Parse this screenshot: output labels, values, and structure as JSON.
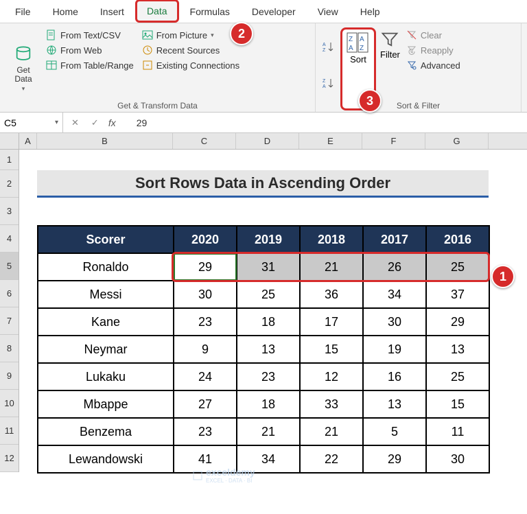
{
  "tabs": [
    "File",
    "Home",
    "Insert",
    "Data",
    "Formulas",
    "Developer",
    "View",
    "Help"
  ],
  "active_tab": "Data",
  "ribbon": {
    "get_data": "Get\nData",
    "from_textcsv": "From Text/CSV",
    "from_web": "From Web",
    "from_table": "From Table/Range",
    "from_picture": "From Picture",
    "recent_sources": "Recent Sources",
    "existing_conn": "Existing Connections",
    "group1_label": "Get & Transform Data",
    "sort_asc": "A→Z",
    "sort_desc": "Z→A",
    "sort": "Sort",
    "filter": "Filter",
    "clear": "Clear",
    "reapply": "Reapply",
    "advanced": "Advanced",
    "group2_label": "Sort & Filter"
  },
  "namebox": "C5",
  "formula_value": "29",
  "columns": [
    "A",
    "B",
    "C",
    "D",
    "E",
    "F",
    "G"
  ],
  "rows": [
    "1",
    "2",
    "3",
    "4",
    "5",
    "6",
    "7",
    "8",
    "9",
    "10",
    "11",
    "12"
  ],
  "title": "Sort Rows Data in Ascending Order",
  "table": {
    "header_scorer": "Scorer",
    "years": [
      "2020",
      "2019",
      "2018",
      "2017",
      "2016"
    ],
    "rows": [
      {
        "name": "Ronaldo",
        "vals": [
          "29",
          "31",
          "21",
          "26",
          "25"
        ]
      },
      {
        "name": "Messi",
        "vals": [
          "30",
          "25",
          "36",
          "34",
          "37"
        ]
      },
      {
        "name": "Kane",
        "vals": [
          "23",
          "18",
          "17",
          "30",
          "29"
        ]
      },
      {
        "name": "Neymar",
        "vals": [
          "9",
          "13",
          "15",
          "19",
          "13"
        ]
      },
      {
        "name": "Lukaku",
        "vals": [
          "24",
          "23",
          "12",
          "16",
          "25"
        ]
      },
      {
        "name": "Mbappe",
        "vals": [
          "27",
          "18",
          "33",
          "13",
          "15"
        ]
      },
      {
        "name": "Benzema",
        "vals": [
          "23",
          "21",
          "21",
          "5",
          "11"
        ]
      },
      {
        "name": "Lewandowski",
        "vals": [
          "41",
          "34",
          "22",
          "29",
          "30"
        ]
      }
    ]
  },
  "callouts": {
    "c1": "1",
    "c2": "2",
    "c3": "3"
  },
  "watermark": "exceldemy",
  "watermark_sub": "EXCEL · DATA · BI"
}
